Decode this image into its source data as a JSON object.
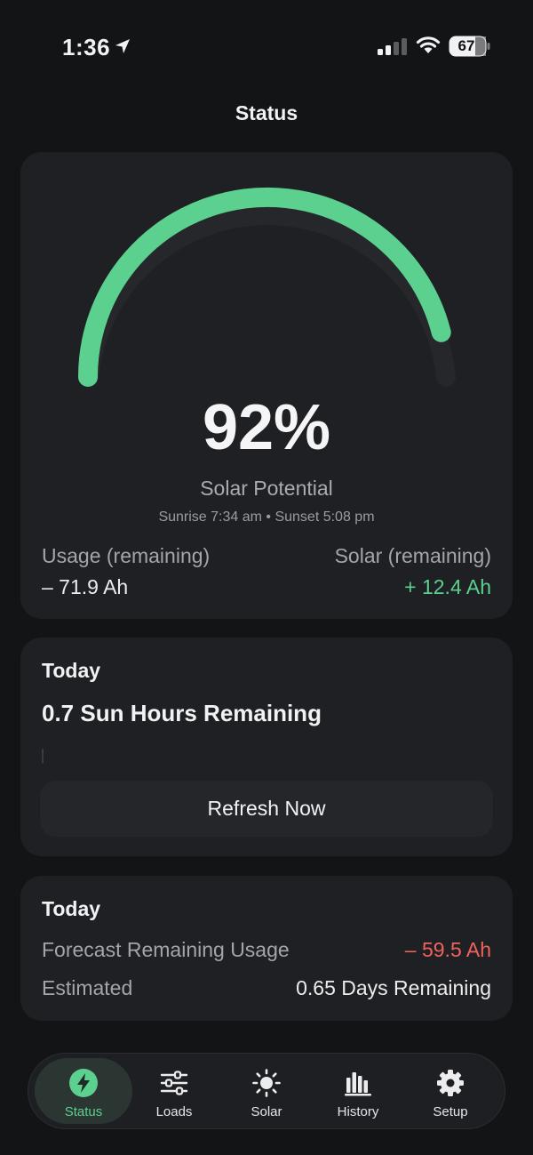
{
  "status_bar": {
    "time": "1:36",
    "battery": "67"
  },
  "nav": {
    "title": "Status"
  },
  "gauge": {
    "value_percent": 92,
    "display": "92%",
    "label": "Solar Potential",
    "sun_times": "Sunrise 7:34 am • Sunset 5:08 pm",
    "accent_color": "#5bd08f"
  },
  "usage": {
    "usage_label": "Usage (remaining)",
    "usage_value": "– 71.9 Ah",
    "solar_label": "Solar (remaining)",
    "solar_value": "+ 12.4 Ah"
  },
  "today_card": {
    "heading": "Today",
    "sun_hours": "0.7 Sun Hours Remaining",
    "refresh_label": "Refresh Now"
  },
  "forecast_card": {
    "heading": "Today",
    "forecast_label": "Forecast Remaining Usage",
    "forecast_value": "– 59.5 Ah",
    "estimated_label": "Estimated",
    "estimated_value": "0.65 Days Remaining"
  },
  "tabs": [
    {
      "label": "Status",
      "icon": "bolt-icon",
      "active": true
    },
    {
      "label": "Loads",
      "icon": "sliders-icon",
      "active": false
    },
    {
      "label": "Solar",
      "icon": "sun-icon",
      "active": false
    },
    {
      "label": "History",
      "icon": "bar-chart-icon",
      "active": false
    },
    {
      "label": "Setup",
      "icon": "gear-icon",
      "active": false
    }
  ]
}
